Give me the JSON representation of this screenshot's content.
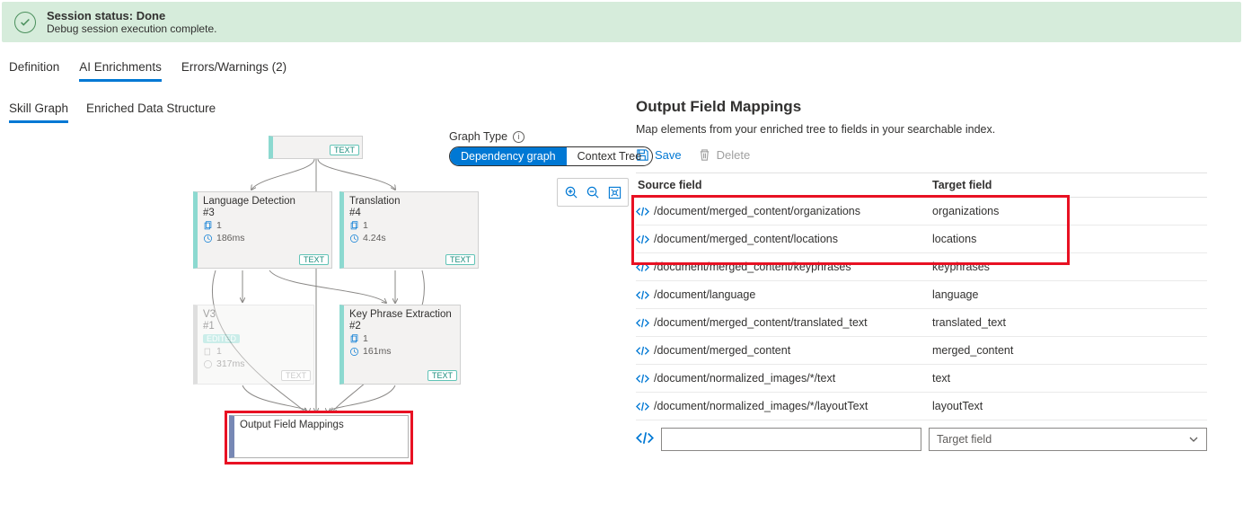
{
  "banner": {
    "title": "Session status: Done",
    "subtitle": "Debug session execution complete."
  },
  "tabs_primary": [
    {
      "label": "Definition",
      "active": false
    },
    {
      "label": "AI Enrichments",
      "active": true
    },
    {
      "label": "Errors/Warnings (2)",
      "active": false
    }
  ],
  "tabs_secondary": [
    {
      "label": "Skill Graph",
      "active": true
    },
    {
      "label": "Enriched Data Structure",
      "active": false
    }
  ],
  "graph_type": {
    "label": "Graph Type",
    "options": [
      {
        "label": "Dependency graph",
        "active": true
      },
      {
        "label": "Context Tree",
        "active": false
      }
    ]
  },
  "nodes": {
    "lang_detect": {
      "title": "Language Detection",
      "num": "#3",
      "count": "1",
      "time": "186ms",
      "badge": "TEXT"
    },
    "translation": {
      "title": "Translation",
      "num": "#4",
      "count": "1",
      "time": "4.24s",
      "badge": "TEXT"
    },
    "v3": {
      "title": "V3",
      "num": "#1",
      "edited": "EDITED",
      "count": "1",
      "time": "317ms",
      "badge": "TEXT"
    },
    "keyphrase": {
      "title": "Key Phrase Extraction",
      "num": "#2",
      "count": "1",
      "time": "161ms",
      "badge": "TEXT"
    },
    "top_badge": "TEXT",
    "output": {
      "title": "Output Field Mappings"
    }
  },
  "panel": {
    "title": "Output Field Mappings",
    "desc": "Map elements from your enriched tree to fields in your searchable index.",
    "save": "Save",
    "delete": "Delete",
    "header_source": "Source field",
    "header_target": "Target field",
    "rows": [
      {
        "source": "/document/merged_content/organizations",
        "target": "organizations"
      },
      {
        "source": "/document/merged_content/locations",
        "target": "locations"
      },
      {
        "source": "/document/merged_content/keyphrases",
        "target": "keyphrases"
      },
      {
        "source": "/document/language",
        "target": "language"
      },
      {
        "source": "/document/merged_content/translated_text",
        "target": "translated_text"
      },
      {
        "source": "/document/merged_content",
        "target": "merged_content"
      },
      {
        "source": "/document/normalized_images/*/text",
        "target": "text"
      },
      {
        "source": "/document/normalized_images/*/layoutText",
        "target": "layoutText"
      }
    ],
    "new_source_placeholder": "",
    "new_target_placeholder": "Target field"
  }
}
